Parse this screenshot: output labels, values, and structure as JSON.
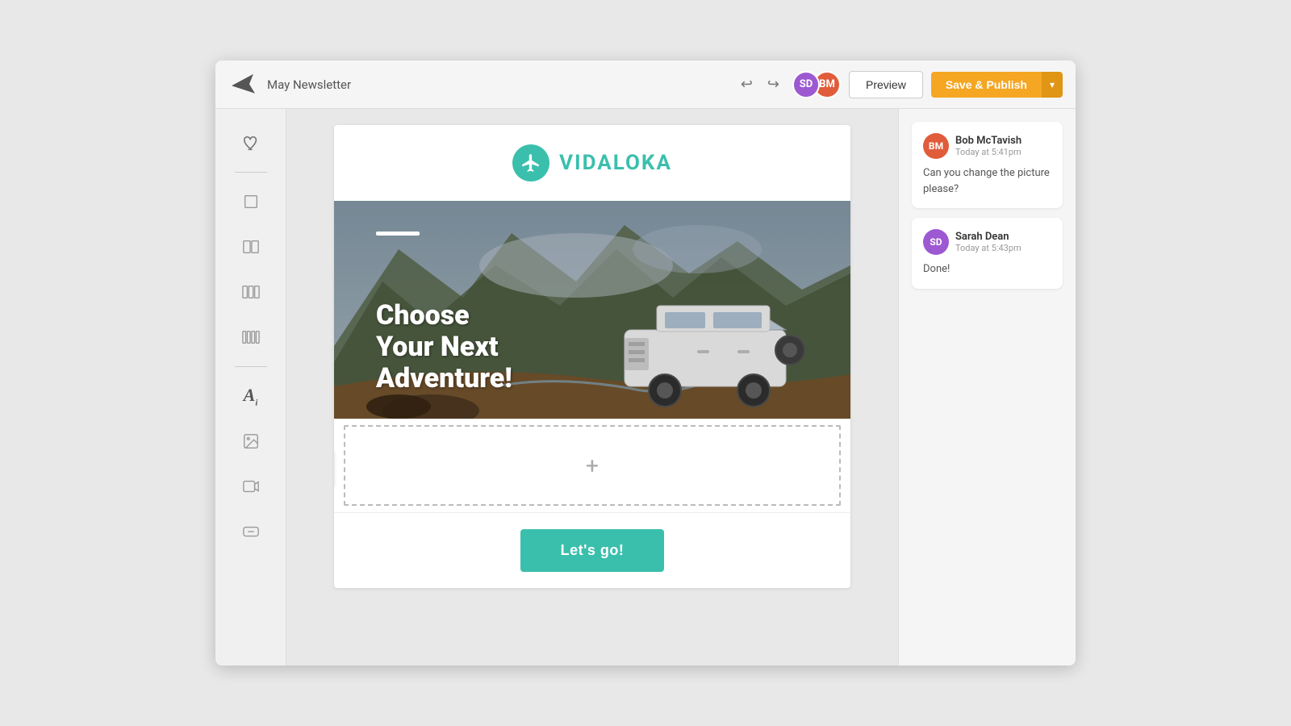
{
  "header": {
    "title": "May Newsletter",
    "preview_label": "Preview",
    "save_publish_label": "Save & Publish",
    "avatar_sd_initials": "SD",
    "avatar_bm_initials": "BM"
  },
  "sidebar": {
    "items": [
      {
        "id": "favorites",
        "icon": "heart",
        "label": "Favorites"
      },
      {
        "id": "layout-single",
        "icon": "layout-single",
        "label": "Single column"
      },
      {
        "id": "layout-split",
        "icon": "layout-split",
        "label": "Split column"
      },
      {
        "id": "layout-3col",
        "icon": "layout-3col",
        "label": "3 columns"
      },
      {
        "id": "layout-4col",
        "icon": "layout-4col",
        "label": "4 columns"
      },
      {
        "id": "text",
        "icon": "text-Ai",
        "label": "Text"
      },
      {
        "id": "image",
        "icon": "image",
        "label": "Image"
      },
      {
        "id": "video",
        "icon": "video",
        "label": "Video"
      },
      {
        "id": "button",
        "icon": "button",
        "label": "Button"
      }
    ]
  },
  "email": {
    "brand_name": "VIDALOKA",
    "hero_heading_line1": "Choose",
    "hero_heading_line2": "Your Next",
    "hero_heading_line3": "Adventure!",
    "cta_label": "Let's go!",
    "drop_zone_plus": "+"
  },
  "comments": [
    {
      "avatar_initials": "BM",
      "avatar_color": "#e05c3a",
      "author": "Bob McTavish",
      "time": "Today at 5:41pm",
      "text": "Can you change the picture please?"
    },
    {
      "avatar_initials": "SD",
      "avatar_color": "#9c59d1",
      "author": "Sarah Dean",
      "time": "Today at 5:43pm",
      "text": "Done!"
    }
  ],
  "colors": {
    "brand_teal": "#3bbfad",
    "save_orange": "#f5a623",
    "avatar_purple": "#9c59d1",
    "avatar_orange": "#e05c3a"
  }
}
